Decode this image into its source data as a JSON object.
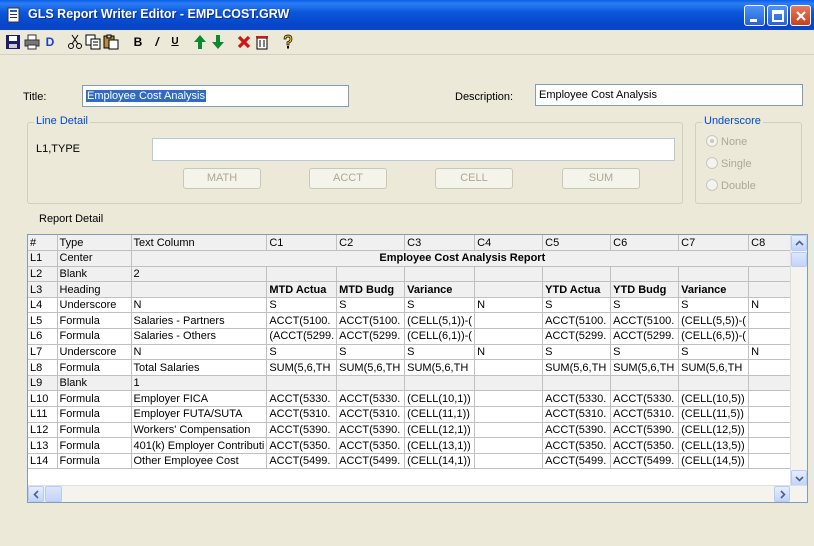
{
  "window": {
    "title": "GLS Report Writer Editor - EMPLCOST.GRW",
    "controls": [
      "minimize-icon",
      "maximize-icon",
      "close-icon"
    ]
  },
  "toolbar": {
    "icons": [
      "save-icon",
      "print-icon",
      "d-icon",
      "cut-icon",
      "copy-icon",
      "paste-icon",
      "bold-icon",
      "italic-icon",
      "underline-icon",
      "move-up-icon",
      "move-down-icon",
      "delete-icon",
      "trash-icon",
      "help-icon"
    ],
    "d_label": "D",
    "bold_label": "B",
    "italic_label": "/",
    "underline_label": "U"
  },
  "form": {
    "title_label": "Title:",
    "title_value": "Employee Cost Analysis",
    "description_label": "Description:",
    "description_value": "Employee Cost Analysis"
  },
  "line_detail": {
    "group_label": "Line Detail",
    "line_label": "L1,TYPE",
    "field_value": "",
    "buttons": [
      "MATH",
      "ACCT",
      "CELL",
      "SUM"
    ]
  },
  "underscore": {
    "group_label": "Underscore",
    "options": [
      "None",
      "Single",
      "Double"
    ],
    "selected": "None"
  },
  "report_detail": {
    "label": "Report Detail",
    "columns": [
      "#",
      "Type",
      "Text Column",
      "C1",
      "C2",
      "C3",
      "C4",
      "C5",
      "C6",
      "C7",
      "C8"
    ],
    "merged_row": {
      "id": "L1",
      "type": "Center",
      "text": "Employee Cost Analysis Report"
    },
    "rows": [
      {
        "id": "L2",
        "type": "Blank",
        "cells": [
          "2",
          "",
          "",
          "",
          "",
          "",
          "",
          "",
          ""
        ],
        "bold": false
      },
      {
        "id": "L3",
        "type": "Heading",
        "cells": [
          "",
          "MTD Actua",
          "MTD Budg",
          "Variance",
          "",
          "YTD Actua",
          "YTD Budg",
          "Variance",
          ""
        ],
        "bold": true
      },
      {
        "id": "L4",
        "type": "Underscore",
        "cells": [
          "N",
          "S",
          "S",
          "S",
          "N",
          "S",
          "S",
          "S",
          "N"
        ],
        "bold": false
      },
      {
        "id": "L5",
        "type": "Formula",
        "cells": [
          "Salaries - Partners",
          "ACCT(5100.",
          "ACCT(5100.",
          "(CELL(5,1))-(",
          "",
          "ACCT(5100.",
          "ACCT(5100.",
          "(CELL(5,5))-(",
          ""
        ],
        "bold": false
      },
      {
        "id": "L6",
        "type": "Formula",
        "cells": [
          "Salaries - Others",
          "(ACCT(5299.",
          "ACCT(5299.",
          "(CELL(6,1))-(",
          "",
          "ACCT(5299.",
          "ACCT(5299.",
          "(CELL(6,5))-(",
          ""
        ],
        "bold": false
      },
      {
        "id": "L7",
        "type": "Underscore",
        "cells": [
          "N",
          "S",
          "S",
          "S",
          "N",
          "S",
          "S",
          "S",
          "N"
        ],
        "bold": false
      },
      {
        "id": "L8",
        "type": "Formula",
        "cells": [
          "Total Salaries",
          "SUM(5,6,TH",
          "SUM(5,6,TH",
          "SUM(5,6,TH",
          "",
          "SUM(5,6,TH",
          "SUM(5,6,TH",
          "SUM(5,6,TH",
          ""
        ],
        "bold": false
      },
      {
        "id": "L9",
        "type": "Blank",
        "cells": [
          "1",
          "",
          "",
          "",
          "",
          "",
          "",
          "",
          ""
        ],
        "bold": false
      },
      {
        "id": "L10",
        "type": "Formula",
        "cells": [
          "Employer FICA",
          "ACCT(5330.",
          "ACCT(5330.",
          "(CELL(10,1))",
          "",
          "ACCT(5330.",
          "ACCT(5330.",
          "(CELL(10,5))",
          ""
        ],
        "bold": false
      },
      {
        "id": "L11",
        "type": "Formula",
        "cells": [
          "Employer FUTA/SUTA",
          "ACCT(5310.",
          "ACCT(5310.",
          "(CELL(11,1))",
          "",
          "ACCT(5310.",
          "ACCT(5310.",
          "(CELL(11,5))",
          ""
        ],
        "bold": false
      },
      {
        "id": "L12",
        "type": "Formula",
        "cells": [
          "Workers' Compensation",
          "ACCT(5390.",
          "ACCT(5390.",
          "(CELL(12,1))",
          "",
          "ACCT(5390.",
          "ACCT(5390.",
          "(CELL(12,5))",
          ""
        ],
        "bold": false
      },
      {
        "id": "L13",
        "type": "Formula",
        "cells": [
          "401(k) Employer Contributi",
          "ACCT(5350.",
          "ACCT(5350.",
          "(CELL(13,1))",
          "",
          "ACCT(5350.",
          "ACCT(5350.",
          "(CELL(13,5))",
          ""
        ],
        "bold": false
      },
      {
        "id": "L14",
        "type": "Formula",
        "cells": [
          "Other Employee Cost",
          "ACCT(5499.",
          "ACCT(5499.",
          "(CELL(14,1))",
          "",
          "ACCT(5499.",
          "ACCT(5499.",
          "(CELL(14,5))",
          ""
        ],
        "bold": false
      }
    ]
  },
  "colors": {
    "titlebar": "#0B58DB",
    "selection": "#316AC5",
    "group_title": "#0046D5",
    "grid_shade": "#F0F0F0"
  }
}
